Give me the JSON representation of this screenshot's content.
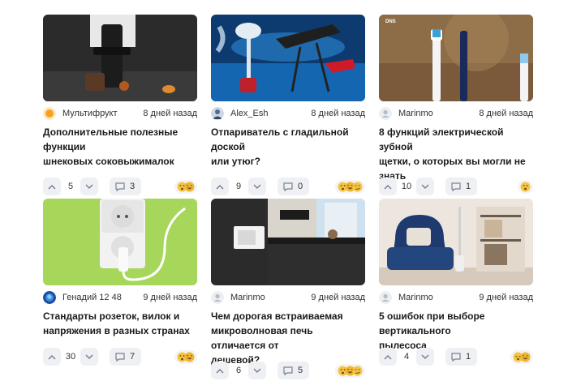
{
  "cards": [
    {
      "author": "Мультифрукт",
      "time": "8 дней назад",
      "title_lines": [
        "Дополнительные полезные функции",
        "шнековых соковыжималок"
      ],
      "votes": "5",
      "comments": "3",
      "image_icon": "juicer-photo",
      "avatar_icon": "orange-avatar-icon",
      "reactions": [
        "surprised",
        "laughing"
      ]
    },
    {
      "author": "Alex_Esh",
      "time": "8 дней назад",
      "title_lines": [
        "Отпариватель с гладильной доской",
        "или утюг?"
      ],
      "votes": "9",
      "comments": "0",
      "image_icon": "steamer-iron-photo",
      "avatar_icon": "user-avatar-icon",
      "reactions": [
        "surprised",
        "laughing",
        "smirk"
      ]
    },
    {
      "author": "Marinmo",
      "time": "8 дней назад",
      "title_lines": [
        "8 функций электрической зубной",
        "щетки, о которых вы могли не знать"
      ],
      "votes": "10",
      "comments": "1",
      "image_icon": "toothbrush-photo",
      "avatar_icon": "default-avatar-icon",
      "reactions": [
        "surprised"
      ]
    },
    {
      "author": "Генадий 12 48",
      "time": "9 дней назад",
      "title_lines": [
        "Стандарты розеток, вилок и",
        "напряжения в разных странах"
      ],
      "votes": "30",
      "comments": "7",
      "image_icon": "socket-plug-photo",
      "avatar_icon": "globe-avatar-icon",
      "reactions": [
        "surprised",
        "laughing"
      ]
    },
    {
      "author": "Marinmo",
      "time": "9 дней назад",
      "title_lines": [
        "Чем дорогая встраиваемая",
        "микроволновая печь отличается от",
        "дешевой?"
      ],
      "votes": "6",
      "comments": "5",
      "image_icon": "kitchen-microwave-photo",
      "avatar_icon": "default-avatar-icon",
      "reactions": [
        "surprised",
        "laughing",
        "smirk"
      ]
    },
    {
      "author": "Marinmo",
      "time": "9 дней назад",
      "title_lines": [
        "5 ошибок при выборе вертикального",
        "пылесоса"
      ],
      "votes": "4",
      "comments": "1",
      "image_icon": "armchair-vacuum-photo",
      "avatar_icon": "default-avatar-icon",
      "reactions": [
        "sleepy",
        "laughing"
      ]
    }
  ],
  "colors": {
    "button_bg": "#eef0f3",
    "text": "#1a1a1a",
    "muted": "#333333",
    "emoji": "#f5c542"
  }
}
